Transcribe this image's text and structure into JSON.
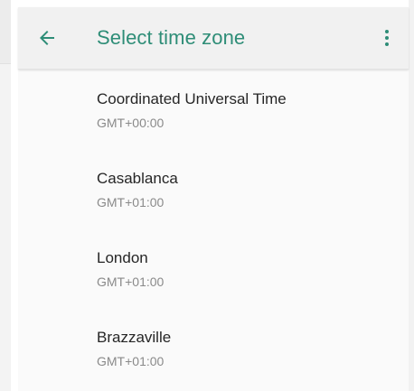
{
  "toolbar": {
    "title": "Select time zone",
    "back_icon": "arrow-back-icon",
    "menu_icon": "more-vert-icon",
    "accent_color": "#2e8d77"
  },
  "timezones": [
    {
      "name": "Coordinated Universal Time",
      "offset": "GMT+00:00"
    },
    {
      "name": "Casablanca",
      "offset": "GMT+01:00"
    },
    {
      "name": "London",
      "offset": "GMT+01:00"
    },
    {
      "name": "Brazzaville",
      "offset": "GMT+01:00"
    }
  ]
}
